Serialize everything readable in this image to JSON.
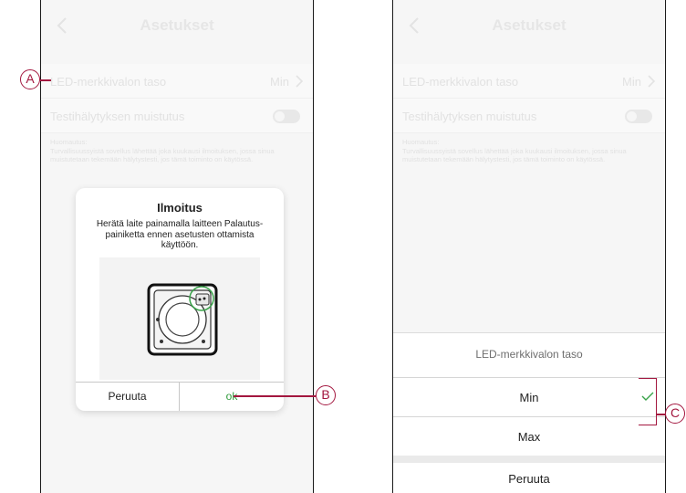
{
  "screen_left": {
    "title": "Asetukset",
    "led_label": "LED-merkkivalon taso",
    "led_value": "Min",
    "test_label": "Testihälytyksen muistutus",
    "note": "Huomautus:\nTurvallisuussyistä sovellus lähettää joka kuukausi ilmoituksen, jossa sinua muistutetaan tekemään hälytystesti, jos tämä toiminto on käytössä.",
    "dialog": {
      "title": "Ilmoitus",
      "message": "Herätä laite painamalla laitteen Palautus-painiketta ennen asetusten ottamista käyttöön.",
      "cancel": "Peruuta",
      "ok": "ok"
    }
  },
  "screen_right": {
    "title": "Asetukset",
    "led_label": "LED-merkkivalon taso",
    "led_value": "Min",
    "test_label": "Testihälytyksen muistutus",
    "note": "Huomautus:\nTurvallisuussyistä sovellus lähettää joka kuukausi ilmoituksen, jossa sinua muistutetaan tekemään hälytystesti, jos tämä toiminto on käytössä.",
    "sheet": {
      "title": "LED-merkkivalon taso",
      "options": [
        "Min",
        "Max"
      ],
      "selected": "Min",
      "cancel": "Peruuta"
    }
  },
  "callouts": {
    "a": "A",
    "b": "B",
    "c": "C"
  },
  "colors": {
    "callout": "#a3173f",
    "ok_green": "#2e9a3a",
    "highlight_green": "#3aa34a"
  }
}
